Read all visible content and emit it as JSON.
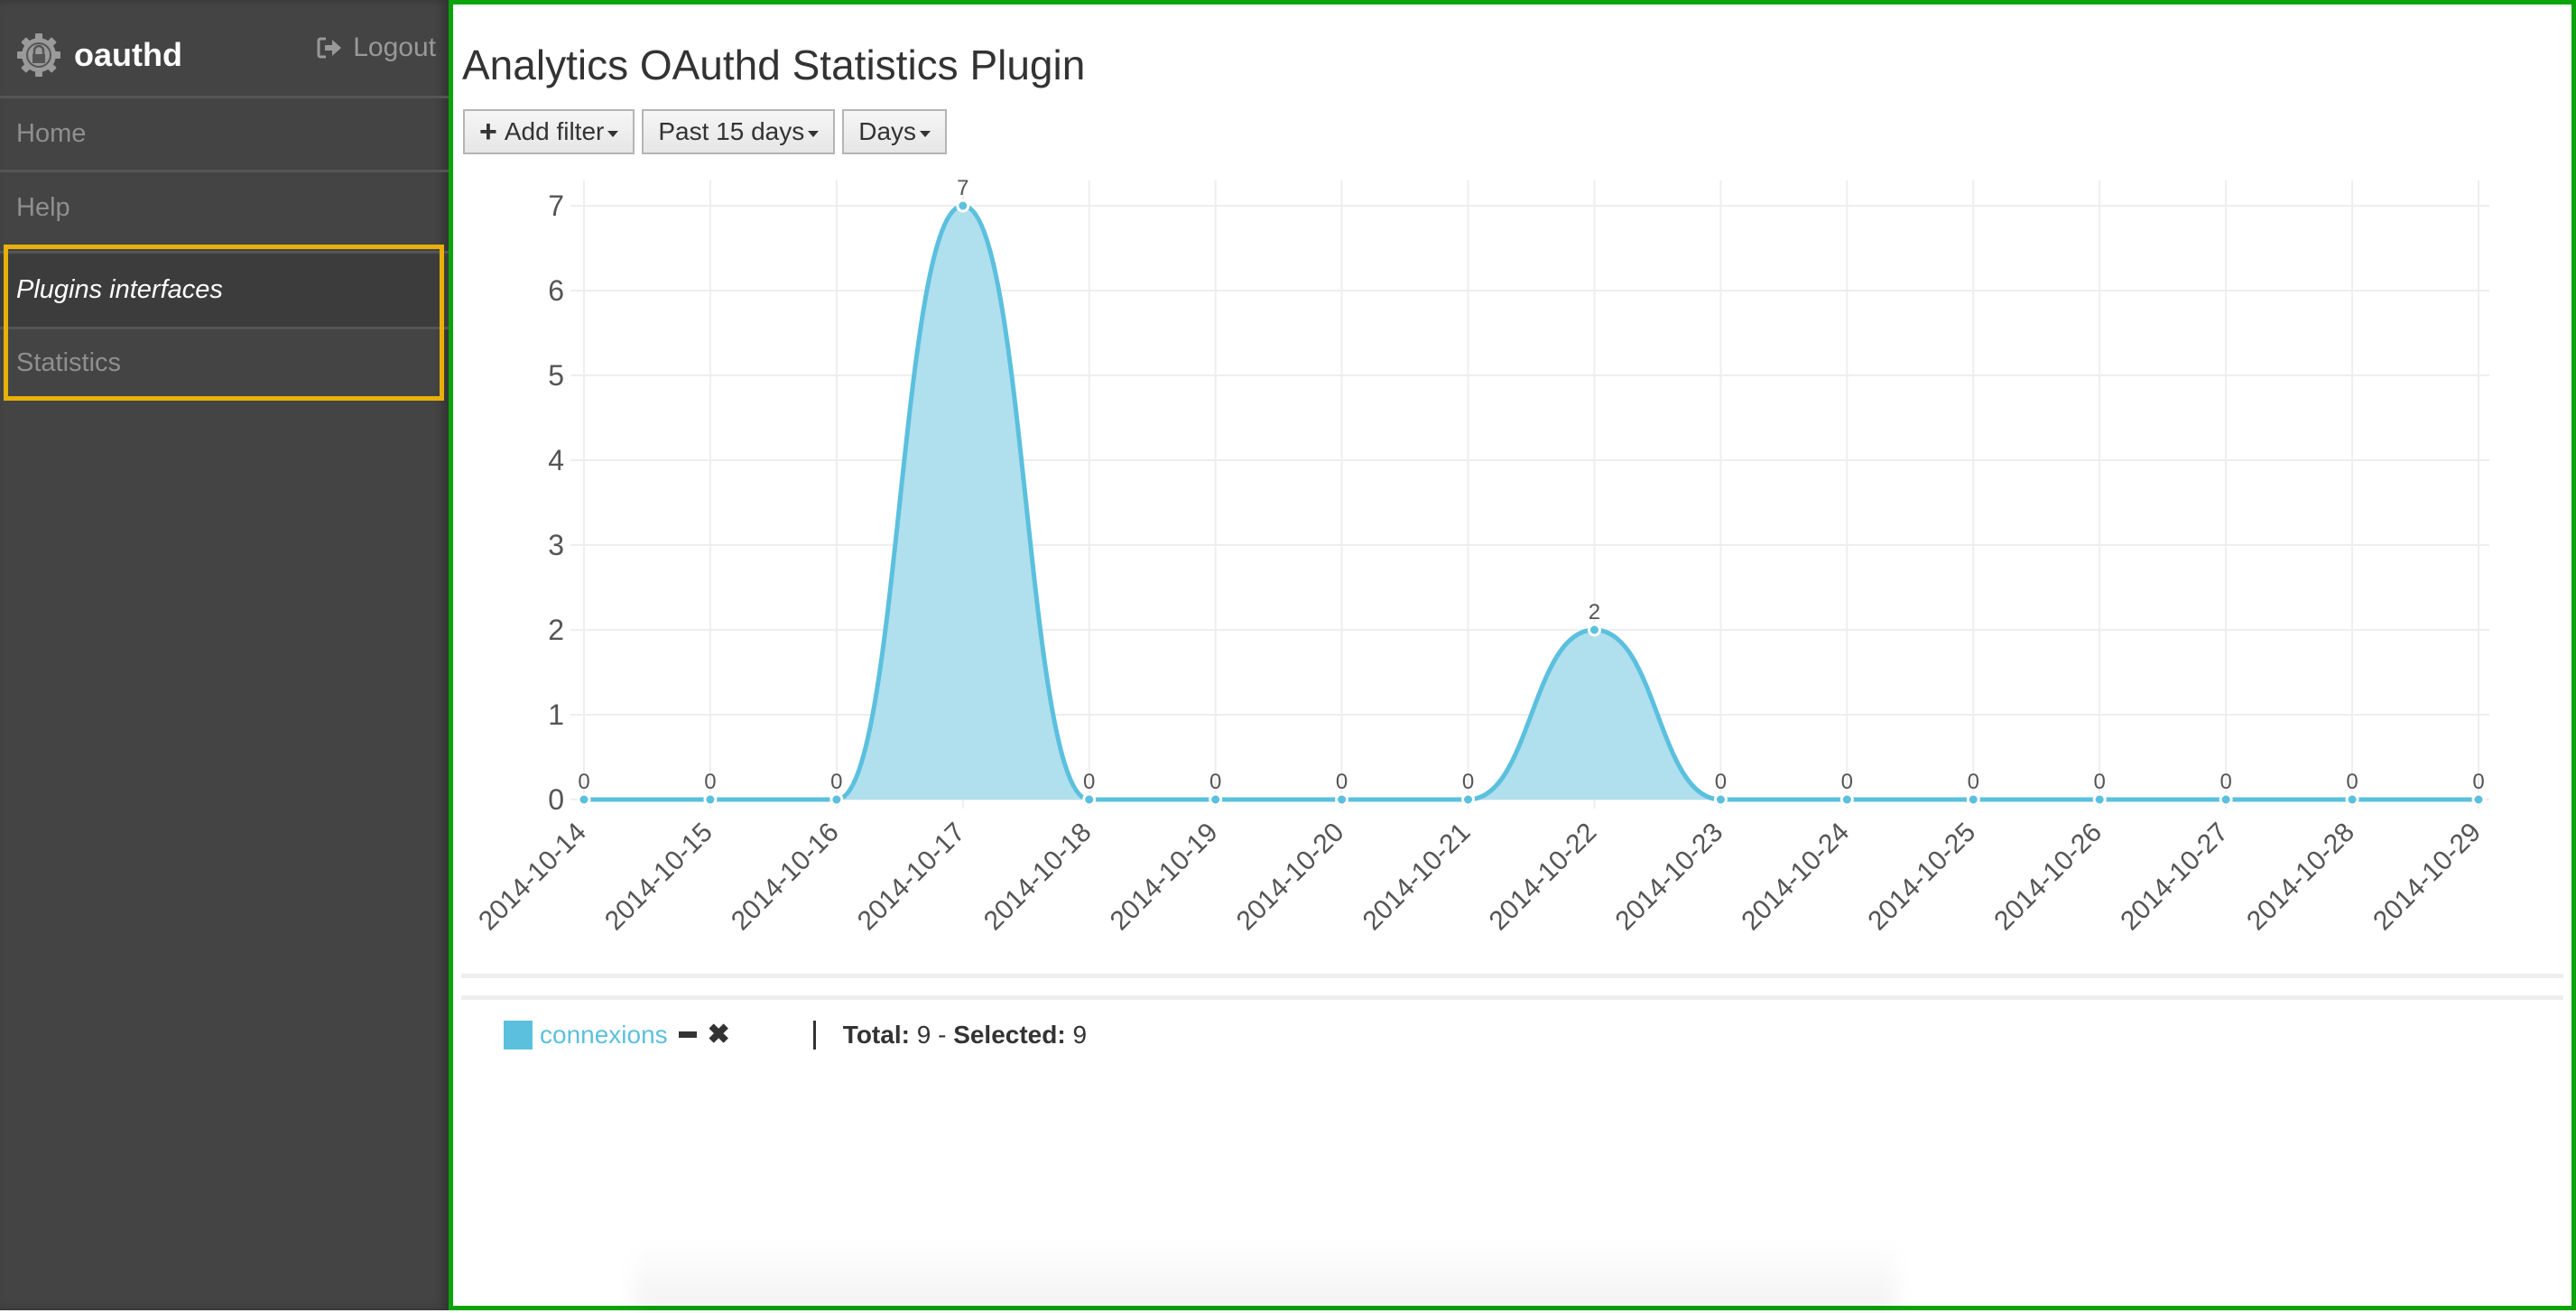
{
  "sidebar": {
    "brand": "oauthd",
    "logout": "Logout",
    "items": [
      {
        "label": "Home"
      },
      {
        "label": "Help"
      },
      {
        "label": "Plugins interfaces"
      },
      {
        "label": "Statistics"
      }
    ]
  },
  "main": {
    "title": "Analytics OAuthd Statistics Plugin",
    "toolbar": {
      "add_filter": "Add filter",
      "range": "Past 15 days",
      "granularity": "Days"
    },
    "legend": {
      "series_label": "connexions",
      "total_label": "Total:",
      "total_value": "9",
      "separator": " - ",
      "selected_label": "Selected:",
      "selected_value": "9"
    }
  },
  "colors": {
    "series": "#5bc0de",
    "sidebar_bg": "#444444",
    "highlight": "#e8b10a",
    "main_border": "#0aa40a"
  },
  "chart_data": {
    "type": "area",
    "title": "",
    "xlabel": "",
    "ylabel": "",
    "x": [
      "2014-10-14",
      "2014-10-15",
      "2014-10-16",
      "2014-10-17",
      "2014-10-18",
      "2014-10-19",
      "2014-10-20",
      "2014-10-21",
      "2014-10-22",
      "2014-10-23",
      "2014-10-24",
      "2014-10-25",
      "2014-10-26",
      "2014-10-27",
      "2014-10-28",
      "2014-10-29"
    ],
    "series": [
      {
        "name": "connexions",
        "values": [
          0,
          0,
          0,
          7,
          0,
          0,
          0,
          0,
          2,
          0,
          0,
          0,
          0,
          0,
          0,
          0
        ]
      }
    ],
    "ylim": [
      0,
      7
    ],
    "yticks": [
      0,
      1,
      2,
      3,
      4,
      5,
      6,
      7
    ],
    "grid": true,
    "data_labels": true,
    "legend": "bottom-left"
  }
}
